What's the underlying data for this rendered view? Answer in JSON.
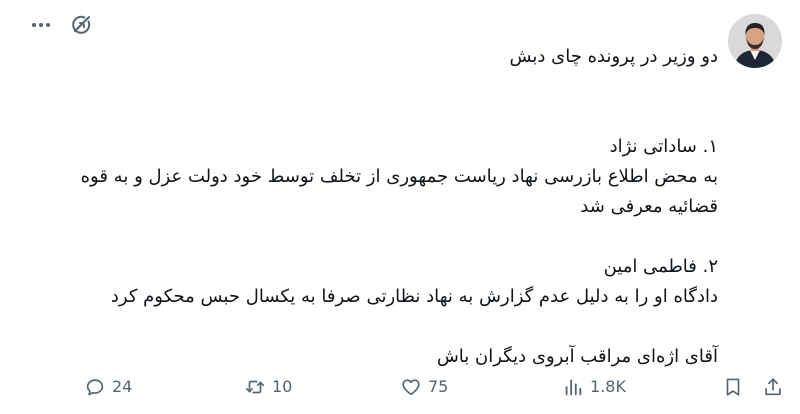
{
  "post": {
    "title_line": "دو وزیر در پرونده چای دبش",
    "item1_heading": "۱. ساداتی نژاد",
    "item1_line1": "به محض اطلاع بازرسی نهاد ریاست جمهوری از تخلف توسط خود دولت عزل و به قوه",
    "item1_line2": "قضائیه معرفی شد",
    "item2_heading": "۲. فاطمی امین",
    "item2_line1": "دادگاه او را به دلیل عدم گزارش به نهاد نظارتی صرفا به یکسال حبس محکوم کرد",
    "closing_line": "آقای اژه‌ای مراقب آبروی دیگران باش"
  },
  "metrics": {
    "replies": "24",
    "reposts": "10",
    "likes": "75",
    "views": "1.8K"
  },
  "icons": {
    "grok": "grok-icon",
    "more": "more-icon",
    "reply": "reply-icon",
    "repost": "repost-icon",
    "like": "like-icon",
    "views": "views-icon",
    "bookmark": "bookmark-icon",
    "share": "share-icon"
  },
  "colors": {
    "text": "#0f1419",
    "muted": "#536471"
  }
}
